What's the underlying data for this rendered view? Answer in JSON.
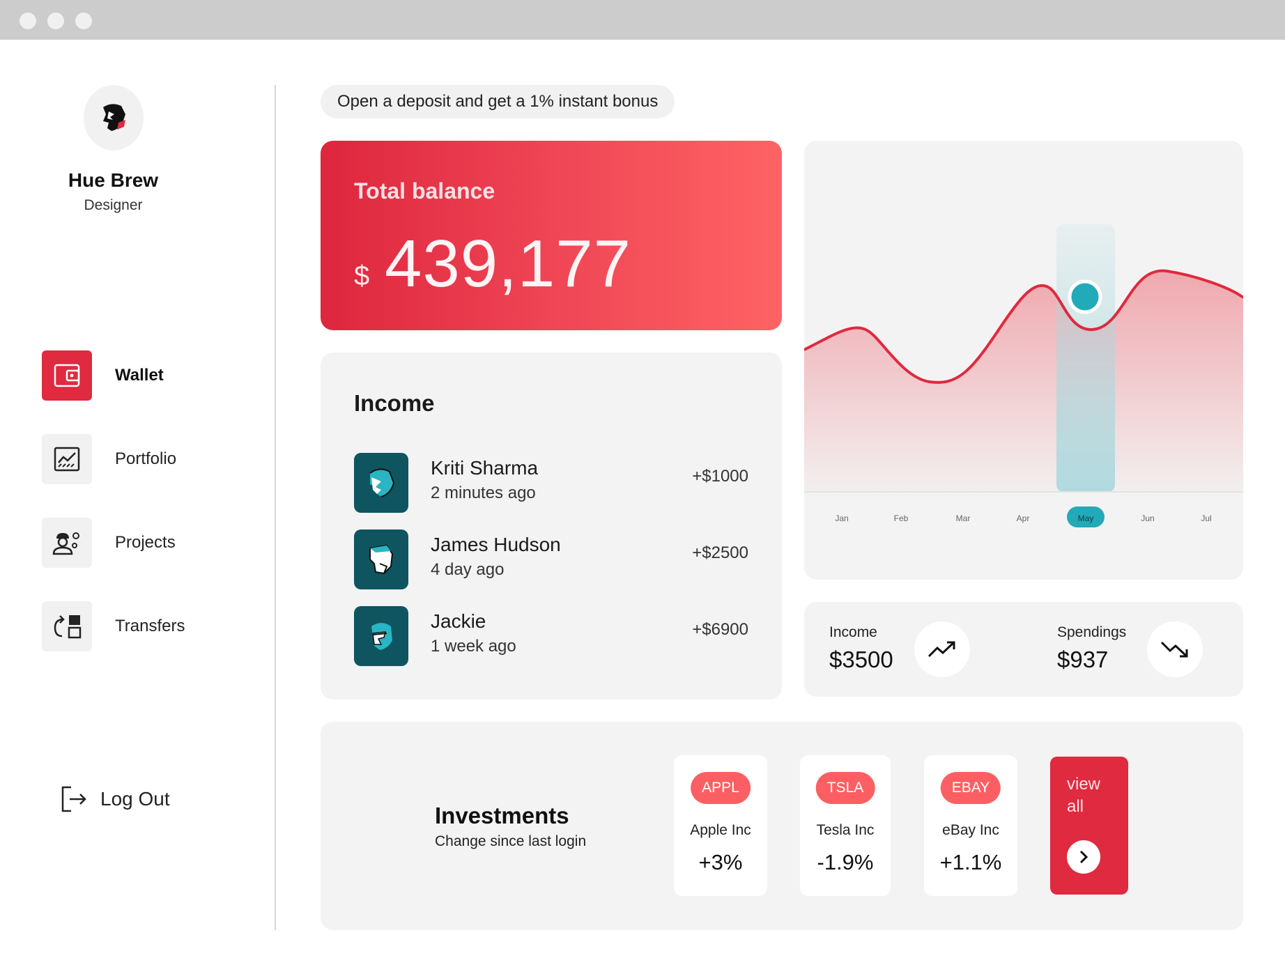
{
  "user": {
    "name": "Hue Brew",
    "role": "Designer"
  },
  "nav": [
    {
      "label": "Wallet",
      "icon": "wallet-icon",
      "active": true
    },
    {
      "label": "Portfolio",
      "icon": "chart-icon",
      "active": false
    },
    {
      "label": "Projects",
      "icon": "worker-gear-icon",
      "active": false
    },
    {
      "label": "Transfers",
      "icon": "transfer-icon",
      "active": false
    }
  ],
  "logout_label": "Log Out",
  "promo": "Open a deposit and get a 1% instant bonus",
  "balance": {
    "title": "Total balance",
    "currency": "$",
    "amount": "439,177"
  },
  "income": {
    "title": "Income",
    "items": [
      {
        "name": "Kriti Sharma",
        "time": "2 minutes ago",
        "amount": "+$1000"
      },
      {
        "name": "James Hudson",
        "time": "4 day ago",
        "amount": "+$2500"
      },
      {
        "name": "Jackie",
        "time": "1 week ago",
        "amount": "+$6900"
      }
    ]
  },
  "chart_data": {
    "type": "area",
    "categories": [
      "Jan",
      "Feb",
      "Mar",
      "Apr",
      "May",
      "Jun",
      "Jul"
    ],
    "highlighted": "May",
    "colors": {
      "line": "#df2a3f",
      "highlight": "#22aab8"
    }
  },
  "summary": {
    "income_label": "Income",
    "income_value": "$3500",
    "spendings_label": "Spendings",
    "spendings_value": "$937"
  },
  "investments": {
    "title": "Investments",
    "subtitle": "Change since last login",
    "stocks": [
      {
        "ticker": "APPL",
        "name": "Apple Inc",
        "change": "+3%"
      },
      {
        "ticker": "TSLA",
        "name": "Tesla Inc",
        "change": "-1.9%"
      },
      {
        "ticker": "EBAY",
        "name": "eBay Inc",
        "change": "+1.1%"
      }
    ],
    "view_all": "view all"
  },
  "colors": {
    "accent": "#df2a3f",
    "teal": "#0e5560",
    "card": "#f3f3f3"
  }
}
